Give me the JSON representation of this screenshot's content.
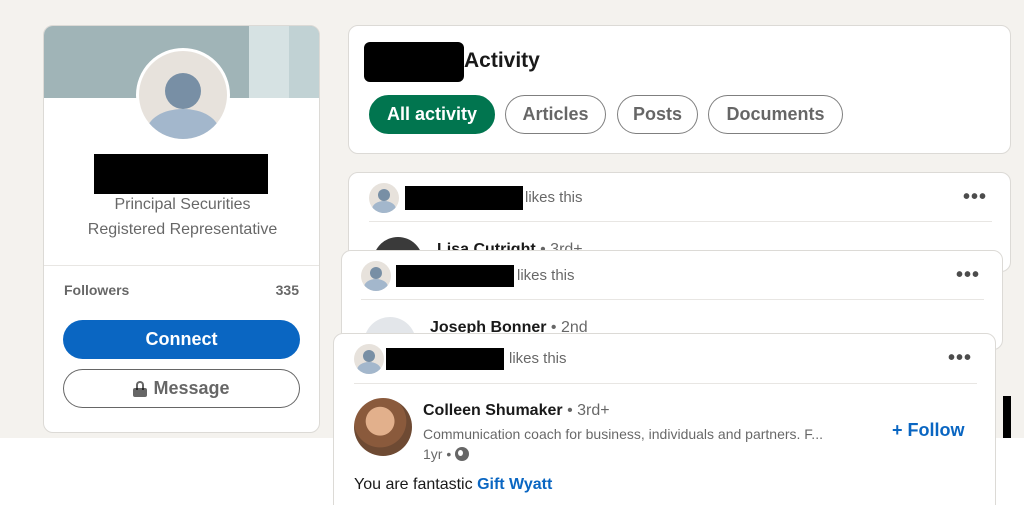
{
  "profile": {
    "headline_line1": "Principal Securities",
    "headline_line2": "Registered Representative",
    "followers_label": "Followers",
    "followers_count": "335",
    "connect_label": "Connect",
    "message_label": "Message"
  },
  "activity": {
    "title": "Activity",
    "tabs": [
      {
        "label": "All activity",
        "active": true
      },
      {
        "label": "Articles",
        "active": false
      },
      {
        "label": "Posts",
        "active": false
      },
      {
        "label": "Documents",
        "active": false
      }
    ]
  },
  "feed": [
    {
      "likes_text": "likes this",
      "author_name": "Lisa Cutright",
      "degree": "• 3rd+"
    },
    {
      "likes_text": "likes this",
      "author_name": "Joseph Bonner",
      "degree": "• 2nd"
    },
    {
      "likes_text": "likes this",
      "author_name": "Colleen Shumaker",
      "degree": "• 3rd+",
      "description": "Communication coach for business, individuals and partners. F...",
      "time": "1yr •",
      "follow_label": "+ Follow",
      "comment_text": "You are fantastic",
      "comment_mention": "Gift Wyatt"
    }
  ],
  "icons": {
    "more": "more-options-icon",
    "lock": "lock-icon",
    "globe": "globe-icon"
  },
  "colors": {
    "primary_blue": "#0a66c2",
    "active_green": "#01754f",
    "page_bg": "#f4f2ee"
  }
}
